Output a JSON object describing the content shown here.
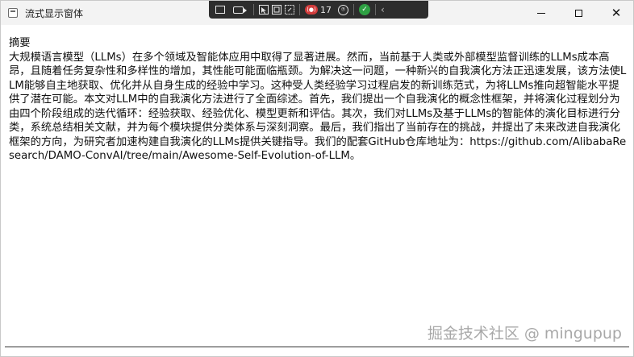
{
  "window": {
    "title": "流式显示窗体",
    "icon": "app-window-icon",
    "controls": {
      "minimize": "minimize-icon",
      "maximize": "maximize-icon",
      "close": "close-icon",
      "close_glyph": "✕"
    }
  },
  "overlay_toolbar": {
    "items": [
      "screenshot-icon",
      "video-camera-icon",
      "cursor-icon",
      "window-capture-icon",
      "region-capture-icon"
    ],
    "record_label": "(●)",
    "record_count": "17",
    "accessibility_glyph": "⍟",
    "confirm_glyph": "✓",
    "collapse_glyph": "‹"
  },
  "content": {
    "heading": "摘要",
    "body": "大规模语言模型（LLMs）在多个领域及智能体应用中取得了显著进展。然而，当前基于人类或外部模型监督训练的LLMs成本高昂，且随着任务复杂性和多样性的增加，其性能可能面临瓶颈。为解决这一问题，一种新兴的自我演化方法正迅速发展，该方法使LLM能够自主地获取、优化并从自身生成的经验中学习。这种受人类经验学习过程启发的新训练范式，为将LLMs推向超智能水平提供了潜在可能。本文对LLM中的自我演化方法进行了全面综述。首先，我们提出一个自我演化的概念性框架，并将演化过程划分为由四个阶段组成的迭代循环：经验获取、经验优化、模型更新和评估。其次，我们对LLMs及基于LLMs的智能体的演化目标进行分类，系统总结相关文献，并为每个模块提供分类体系与深刻洞察。最后，我们指出了当前存在的挑战，并提出了未来改进自我演化框架的方向，为研究者加速构建自我演化的LLMs提供关键指导。我们的配套GitHub仓库地址为：https://github.com/AlibabaResearch/DAMO-ConvAI/tree/main/Awesome-Self-Evolution-of-LLM。"
  },
  "watermark": "掘金技术社区 @ mingupup"
}
